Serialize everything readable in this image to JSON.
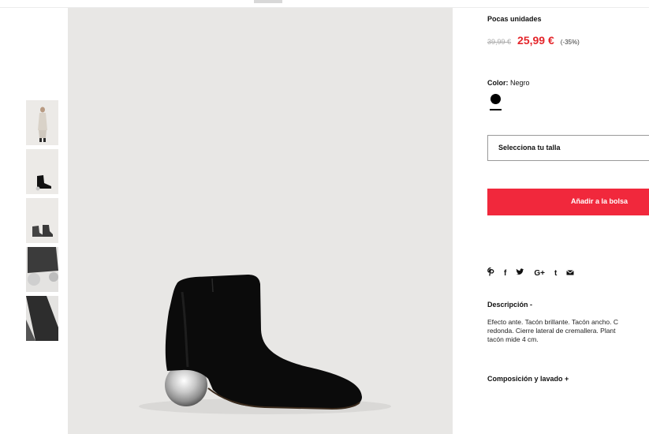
{
  "product": {
    "stock_notice": "Pocas unidades",
    "old_price": "39,99 €",
    "new_price": "25,99 €",
    "discount": "(-35%)",
    "color_label": "Color:",
    "color_value": "Negro",
    "swatch_color": "#000000",
    "size_placeholder": "Selecciona tu talla",
    "add_to_bag": "Añadir a la bolsa",
    "description_title": "Descripción -",
    "description_lines": [
      "Efecto ante. Tacón brillante. Tacón ancho. C",
      "redonda. Cierre lateral de cremallera. Plant",
      "tacón mide 4 cm."
    ],
    "composition_title": "Composición y lavado +"
  },
  "share": {
    "icons": [
      "pinterest-icon",
      "facebook-icon",
      "twitter-icon",
      "google-plus-icon",
      "tumblr-icon",
      "email-icon"
    ],
    "glyphs": [
      "℗",
      "f",
      "𝕪",
      "G+",
      "t",
      "✉"
    ]
  },
  "colors": {
    "accent": "#f1283c",
    "sale_price": "#e4262b",
    "image_bg": "#e8e7e5"
  }
}
